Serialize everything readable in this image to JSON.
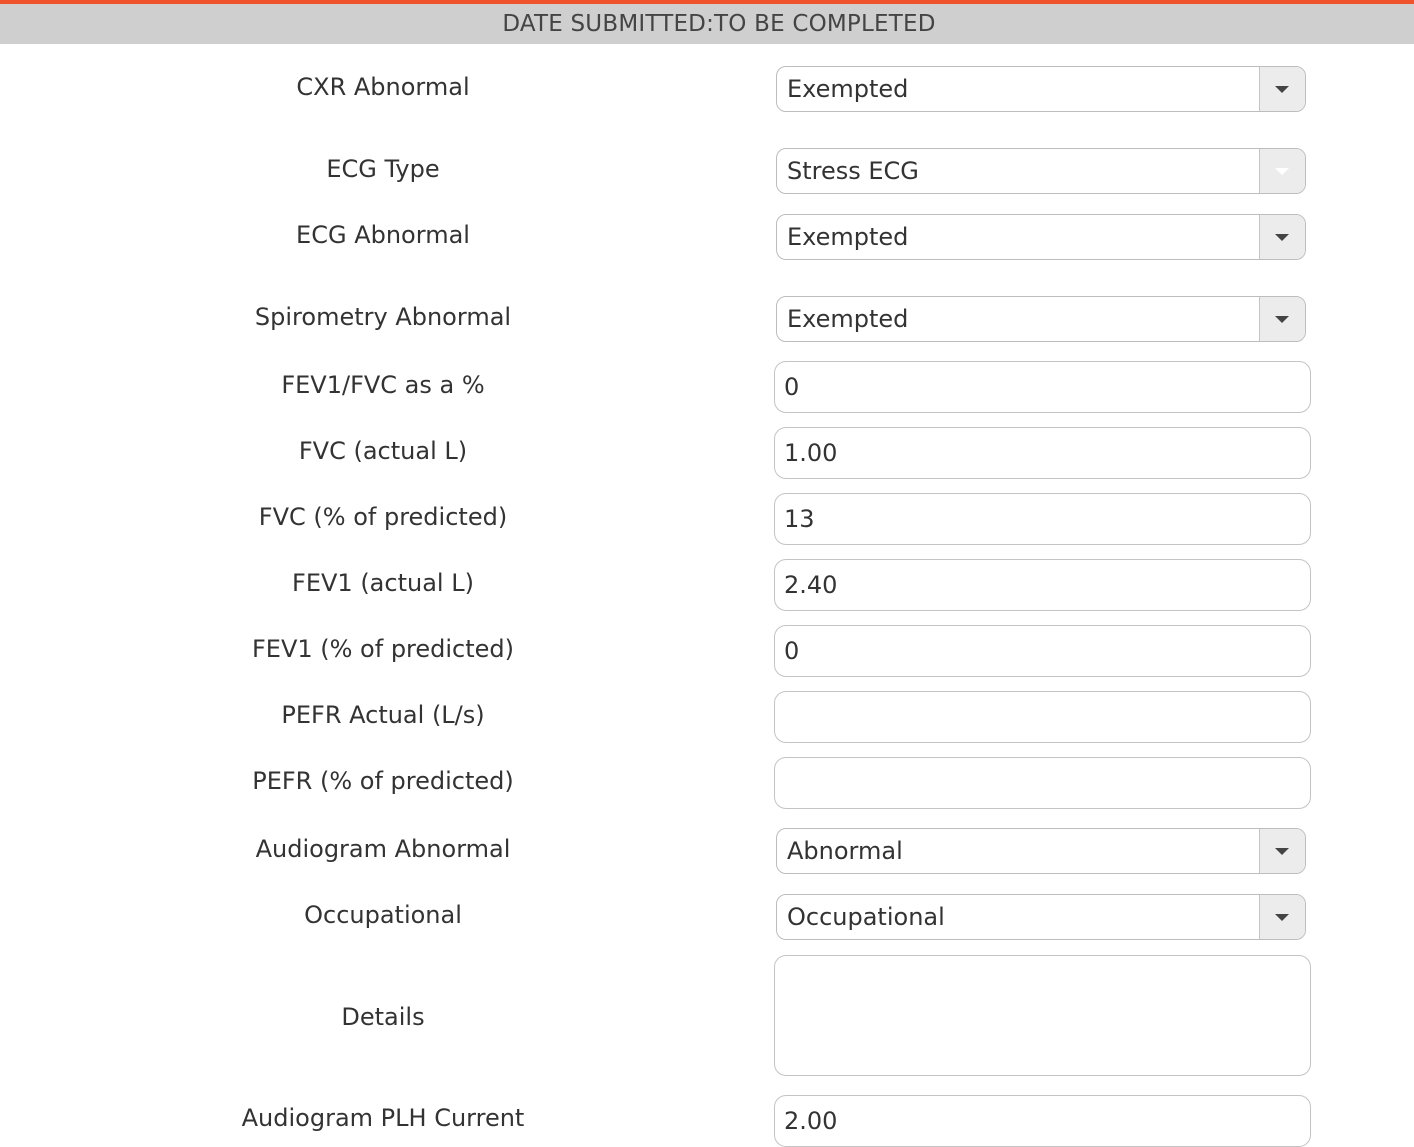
{
  "colors": {
    "accent": "#f0532b",
    "header_bg": "#cfcfcf"
  },
  "header": {
    "title": "DATE SUBMITTED:TO BE COMPLETED"
  },
  "form": {
    "cxr_abnormal": {
      "label": "CXR Abnormal",
      "value": "Exempted",
      "icon": "chevron-down-icon"
    },
    "ecg_type": {
      "label": "ECG Type",
      "value": "Stress ECG",
      "icon": "chevron-down-icon",
      "disabled": true
    },
    "ecg_abnormal": {
      "label": "ECG Abnormal",
      "value": "Exempted",
      "icon": "chevron-down-icon"
    },
    "spirometry_abnormal": {
      "label": "Spirometry Abnormal",
      "value": "Exempted",
      "icon": "chevron-down-icon"
    },
    "fev1_fvc_pct": {
      "label": "FEV1/FVC as a %",
      "value": "0"
    },
    "fvc_actual": {
      "label": "FVC (actual L)",
      "value": "1.00"
    },
    "fvc_pct_predicted": {
      "label": "FVC (% of predicted)",
      "value": "13"
    },
    "fev1_actual": {
      "label": "FEV1 (actual L)",
      "value": "2.40"
    },
    "fev1_pct_predicted": {
      "label": "FEV1 (% of predicted)",
      "value": "0"
    },
    "pefr_actual": {
      "label": "PEFR Actual (L/s)",
      "value": ""
    },
    "pefr_pct_predicted": {
      "label": "PEFR (% of predicted)",
      "value": ""
    },
    "audiogram_abnormal": {
      "label": "Audiogram Abnormal",
      "value": "Abnormal",
      "icon": "chevron-down-icon"
    },
    "occupational": {
      "label": "Occupational",
      "value": "Occupational",
      "icon": "chevron-down-icon"
    },
    "details": {
      "label": "Details",
      "value": ""
    },
    "audiogram_plh_current": {
      "label": "Audiogram PLH Current",
      "value": "2.00"
    }
  }
}
